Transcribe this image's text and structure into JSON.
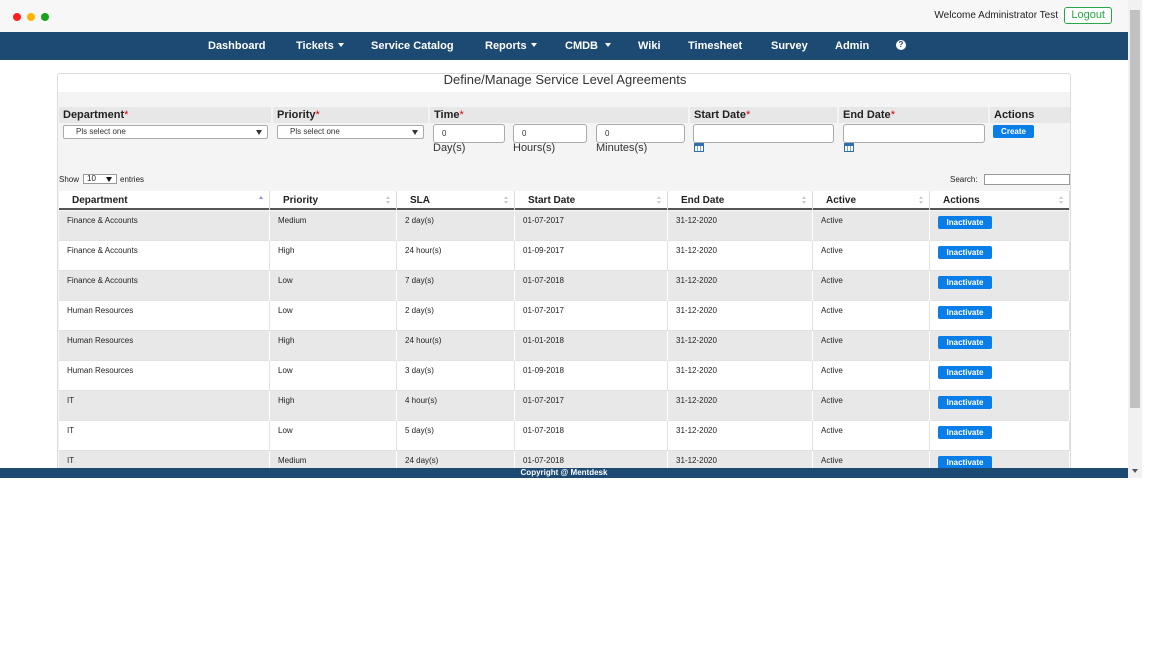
{
  "header": {
    "welcome_text": "Welcome Administrator Test",
    "logout_label": "Logout"
  },
  "nav": {
    "items": [
      {
        "label": "Dashboard"
      },
      {
        "label": "Tickets"
      },
      {
        "label": "Service Catalog"
      },
      {
        "label": "Reports"
      },
      {
        "label": "CMDB"
      },
      {
        "label": "Wiki"
      },
      {
        "label": "Timesheet"
      },
      {
        "label": "Survey"
      },
      {
        "label": "Admin"
      }
    ],
    "help_glyph": "?"
  },
  "panel": {
    "title": "Define/Manage Service Level Agreements"
  },
  "form": {
    "department_label": "Department",
    "priority_label": "Priority",
    "time_label": "Time",
    "start_date_label": "Start Date",
    "end_date_label": "End Date",
    "actions_label": "Actions",
    "required_marker": "*",
    "department_value": "Pls select one",
    "priority_value": "Pls select one",
    "days_value": "0",
    "hours_value": "0",
    "minutes_value": "0",
    "days_unit": "Day(s)",
    "hours_unit": "Hours(s)",
    "minutes_unit": "Minutes(s)",
    "create_label": "Create"
  },
  "table_controls": {
    "show_label": "Show",
    "entries_value": "10",
    "entries_label": "entries",
    "search_label": "Search:"
  },
  "table": {
    "columns": [
      "Department",
      "Priority",
      "SLA",
      "Start Date",
      "End Date",
      "Active",
      "Actions"
    ],
    "rows": [
      {
        "department": "Finance & Accounts",
        "priority": "Medium",
        "sla": "2 day(s)",
        "start": "01-07-2017",
        "end": "31-12-2020",
        "active": "Active",
        "action": "Inactivate"
      },
      {
        "department": "Finance & Accounts",
        "priority": "High",
        "sla": "24 hour(s)",
        "start": "01-09-2017",
        "end": "31-12-2020",
        "active": "Active",
        "action": "Inactivate"
      },
      {
        "department": "Finance & Accounts",
        "priority": "Low",
        "sla": "7 day(s)",
        "start": "01-07-2018",
        "end": "31-12-2020",
        "active": "Active",
        "action": "Inactivate"
      },
      {
        "department": "Human Resources",
        "priority": "Low",
        "sla": "2 day(s)",
        "start": "01-07-2017",
        "end": "31-12-2020",
        "active": "Active",
        "action": "Inactivate"
      },
      {
        "department": "Human Resources",
        "priority": "High",
        "sla": "24 hour(s)",
        "start": "01-01-2018",
        "end": "31-12-2020",
        "active": "Active",
        "action": "Inactivate"
      },
      {
        "department": "Human Resources",
        "priority": "Low",
        "sla": "3 day(s)",
        "start": "01-09-2018",
        "end": "31-12-2020",
        "active": "Active",
        "action": "Inactivate"
      },
      {
        "department": "IT",
        "priority": "High",
        "sla": "4 hour(s)",
        "start": "01-07-2017",
        "end": "31-12-2020",
        "active": "Active",
        "action": "Inactivate"
      },
      {
        "department": "IT",
        "priority": "Low",
        "sla": "5 day(s)",
        "start": "01-07-2018",
        "end": "31-12-2020",
        "active": "Active",
        "action": "Inactivate"
      },
      {
        "department": "IT",
        "priority": "Medium",
        "sla": "24 day(s)",
        "start": "01-07-2018",
        "end": "31-12-2020",
        "active": "Active",
        "action": "Inactivate"
      }
    ]
  },
  "footer": {
    "copyright": "Copyright @ Mentdesk"
  },
  "colors": {
    "nav_bg": "#1c4a72",
    "primary_button": "#0a7ee8",
    "logout_border": "#28a745",
    "required": "#dd0000"
  },
  "icons": {
    "window_controls": [
      "red-dot",
      "yellow-dot",
      "green-dot"
    ],
    "help": "question-circle-icon",
    "calendar": "calendar-icon"
  }
}
